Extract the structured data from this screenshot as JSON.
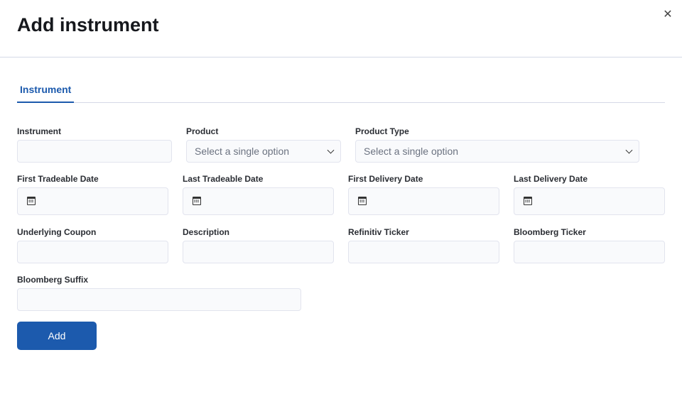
{
  "dialog": {
    "title": "Add instrument",
    "close_icon": "close-icon"
  },
  "tabs": [
    {
      "label": "Instrument",
      "active": true
    }
  ],
  "fields": {
    "instrument": {
      "label": "Instrument",
      "value": ""
    },
    "product": {
      "label": "Product",
      "placeholder": "Select a single option"
    },
    "product_type": {
      "label": "Product Type",
      "placeholder": "Select a single option"
    },
    "first_tradeable_date": {
      "label": "First Tradeable Date",
      "value": ""
    },
    "last_tradeable_date": {
      "label": "Last Tradeable Date",
      "value": ""
    },
    "first_delivery_date": {
      "label": "First Delivery Date",
      "value": ""
    },
    "last_delivery_date": {
      "label": "Last Delivery Date",
      "value": ""
    },
    "underlying_coupon": {
      "label": "Underlying Coupon",
      "value": ""
    },
    "description": {
      "label": "Description",
      "value": ""
    },
    "refinitiv_ticker": {
      "label": "Refinitiv Ticker",
      "value": ""
    },
    "bloomberg_ticker": {
      "label": "Bloomberg Ticker",
      "value": ""
    },
    "bloomberg_suffix": {
      "label": "Bloomberg Suffix",
      "value": ""
    }
  },
  "actions": {
    "add_label": "Add"
  },
  "colors": {
    "accent": "#1c5aad"
  }
}
